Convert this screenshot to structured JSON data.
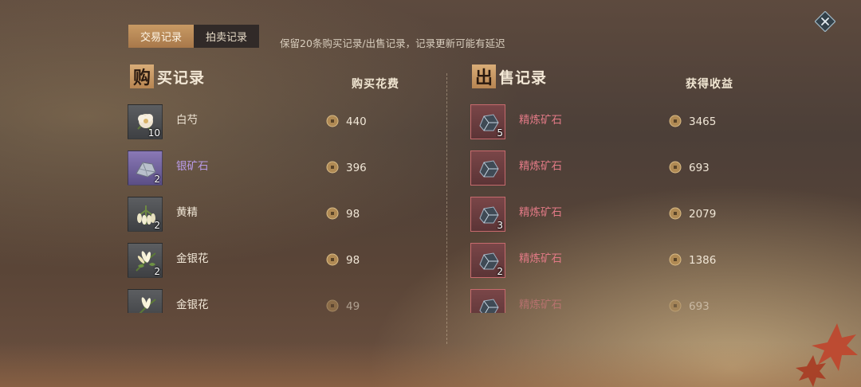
{
  "tabs": [
    {
      "label": "交易记录",
      "active": true
    },
    {
      "label": "拍卖记录",
      "active": false
    }
  ],
  "notice": "保留20条购买记录/出售记录，记录更新可能有延迟",
  "buy": {
    "title_badge": "购",
    "title_rest": "买记录",
    "col_header": "购买花费",
    "items": [
      {
        "name": "白芍",
        "qty": "10",
        "price": "440",
        "icon": "flower-icon",
        "rarity": "normal"
      },
      {
        "name": "银矿石",
        "qty": "2",
        "price": "396",
        "icon": "silver-ore-icon",
        "rarity": "purple"
      },
      {
        "name": "黄精",
        "qty": "2",
        "price": "98",
        "icon": "herb-icon",
        "rarity": "normal"
      },
      {
        "name": "金银花",
        "qty": "2",
        "price": "98",
        "icon": "honeysuckle-icon",
        "rarity": "normal"
      },
      {
        "name": "金银花",
        "qty": "",
        "price": "49",
        "icon": "honeysuckle-icon",
        "rarity": "normal"
      }
    ]
  },
  "sell": {
    "title_badge": "出",
    "title_rest": "售记录",
    "col_header": "获得收益",
    "items": [
      {
        "name": "精炼矿石",
        "qty": "5",
        "price": "3465",
        "icon": "refined-ore-icon"
      },
      {
        "name": "精炼矿石",
        "qty": "",
        "price": "693",
        "icon": "refined-ore-icon"
      },
      {
        "name": "精炼矿石",
        "qty": "3",
        "price": "2079",
        "icon": "refined-ore-icon"
      },
      {
        "name": "精炼矿石",
        "qty": "2",
        "price": "1386",
        "icon": "refined-ore-icon"
      },
      {
        "name": "精炼矿石",
        "qty": "",
        "price": "693",
        "icon": "refined-ore-icon"
      }
    ]
  },
  "colors": {
    "accent": "#b88550",
    "sell_name": "#e27a86",
    "purple_name": "#b89ae6"
  }
}
